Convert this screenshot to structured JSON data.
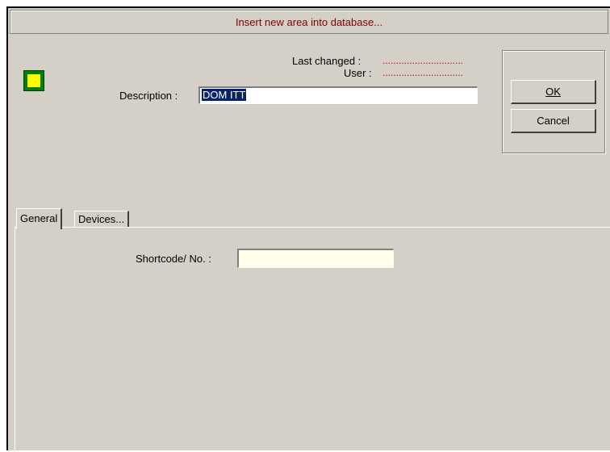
{
  "dialog": {
    "title": "Insert new area into database..."
  },
  "colors": {
    "area_fill": "#ffff00",
    "area_border": "#008000",
    "title_text": "#800000",
    "dots": "#c00000"
  },
  "info": {
    "last_changed_label": "Last changed :",
    "last_changed_value": "..............................",
    "user_label": "User :",
    "user_value": ".............................."
  },
  "description": {
    "label": "Description :",
    "value": "DOM ITT"
  },
  "buttons": {
    "ok": "OK",
    "cancel": "Cancel"
  },
  "tabs": [
    {
      "label": "General",
      "active": true
    },
    {
      "label": "Devices...",
      "active": false
    }
  ],
  "general": {
    "shortcode_label": "Shortcode/ No. :",
    "shortcode_value": ""
  }
}
